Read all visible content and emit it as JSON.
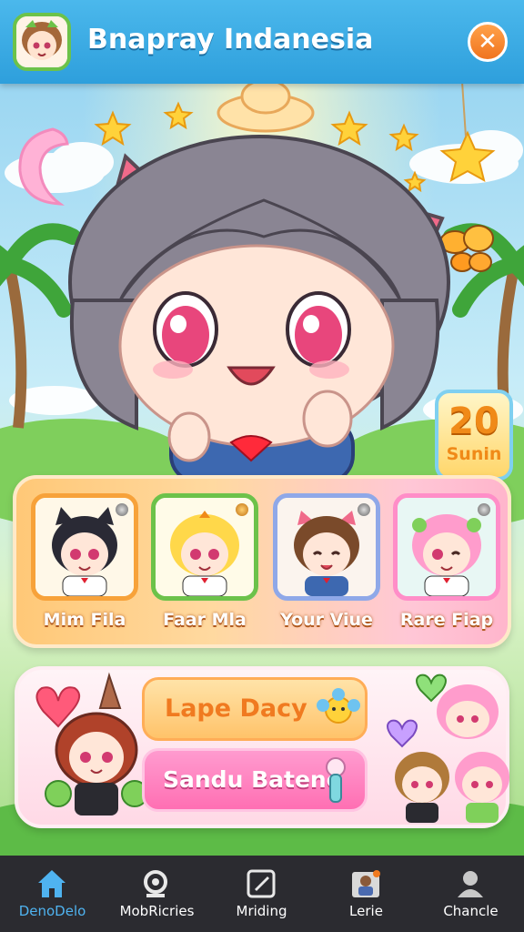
{
  "header": {
    "title": "Bnapray Indanesia",
    "close_icon": "close-icon",
    "accent_color": "#2e9fdc"
  },
  "level_badge": {
    "number": "20",
    "label": "Sunin"
  },
  "roster": {
    "characters": [
      {
        "name": "Mim Fila",
        "frame_color": "#f7a23a"
      },
      {
        "name": "Faar Mla",
        "frame_color": "#6cc24a"
      },
      {
        "name": "Your Viue",
        "frame_color": "#8fa8e8"
      },
      {
        "name": "Rare Fiap",
        "frame_color": "#ff8ec8"
      }
    ]
  },
  "actions": {
    "primary_label": "Lape Dacy",
    "secondary_label": "Sandu Batene"
  },
  "tabs": [
    {
      "label": "DenoDelo",
      "icon": "home-icon",
      "active": true
    },
    {
      "label": "MobRicries",
      "icon": "search-icon",
      "active": false
    },
    {
      "label": "Mriding",
      "icon": "edit-icon",
      "active": false
    },
    {
      "label": "Lerie",
      "icon": "profile-card-icon",
      "active": false
    },
    {
      "label": "Chancle",
      "icon": "user-icon",
      "active": false
    }
  ]
}
